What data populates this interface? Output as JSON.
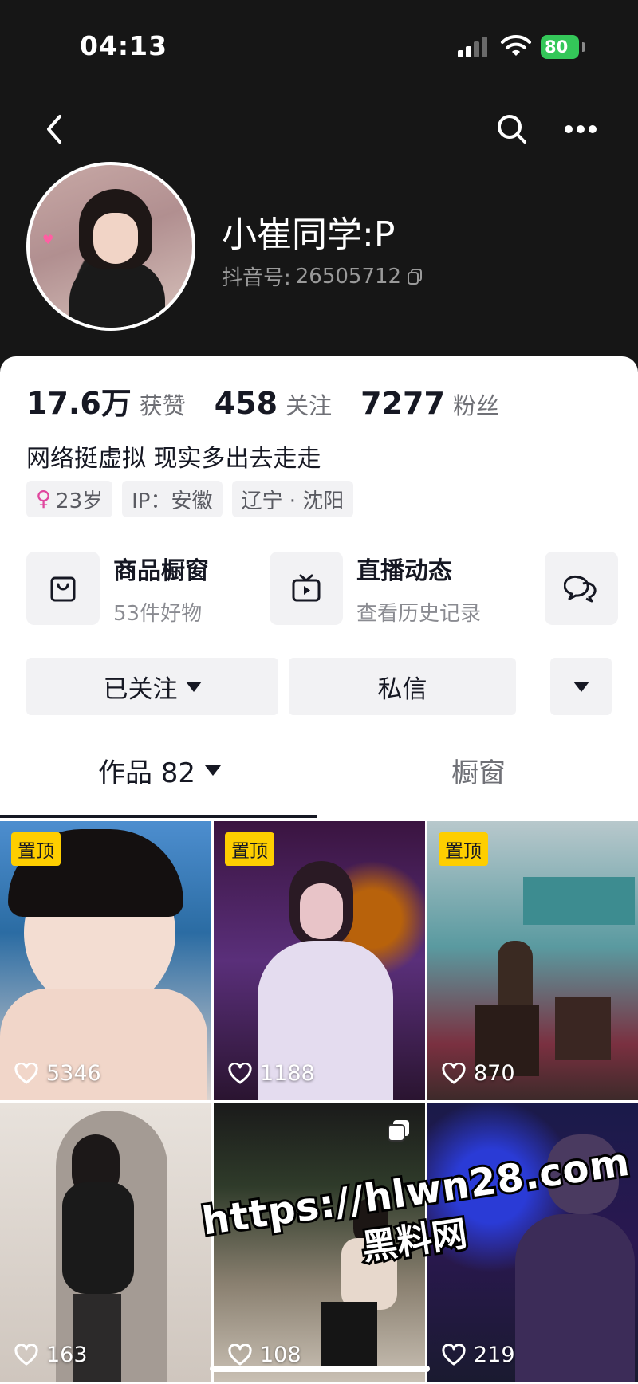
{
  "status_bar": {
    "time": "04:13",
    "battery": "80"
  },
  "profile": {
    "nickname": "小崔同学:P",
    "douyin_id_label": "抖音号:",
    "douyin_id": "26505712"
  },
  "stats": [
    {
      "value": "17.6万",
      "label": "获赞"
    },
    {
      "value": "458",
      "label": "关注"
    },
    {
      "value": "7277",
      "label": "粉丝"
    }
  ],
  "bio": "网络挺虚拟 现实多出去走走",
  "tags": {
    "age": "23岁",
    "ip": "IP：安徽",
    "location": "辽宁 · 沈阳"
  },
  "features": [
    {
      "title": "商品橱窗",
      "subtitle": "53件好物",
      "icon": "bag-icon"
    },
    {
      "title": "直播动态",
      "subtitle": "查看历史记录",
      "icon": "tv-icon"
    },
    {
      "title": "",
      "subtitle": "",
      "icon": "chat-bubble-icon"
    }
  ],
  "actions": {
    "followed": "已关注",
    "message": "私信"
  },
  "tabs": {
    "works": "作品 82",
    "shop": "橱窗"
  },
  "videos": [
    {
      "pinned": "置顶",
      "likes": "5346"
    },
    {
      "pinned": "置顶",
      "likes": "1188"
    },
    {
      "pinned": "置顶",
      "likes": "870"
    },
    {
      "pinned": "",
      "likes": "163"
    },
    {
      "pinned": "",
      "likes": "108",
      "multi_image": true
    },
    {
      "pinned": "",
      "likes": "219"
    }
  ],
  "watermark": {
    "url": "https://hlwn28.com",
    "name": "黑料网"
  },
  "colors": {
    "pin_badge": "#fece00",
    "battery": "#34c759",
    "dark_bg": "#161616"
  }
}
